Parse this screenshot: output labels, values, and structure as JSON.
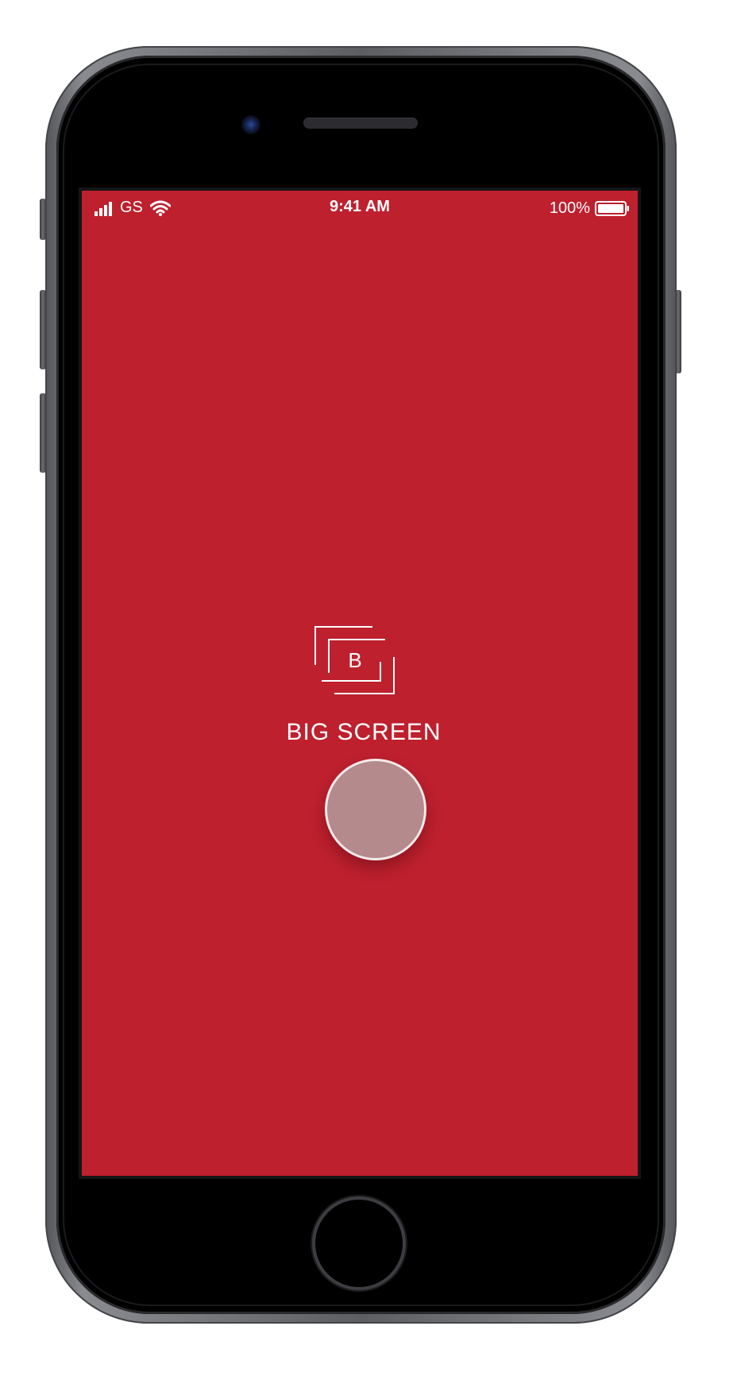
{
  "status_bar": {
    "carrier": "GS",
    "time": "9:41 AM",
    "battery_percent": "100%",
    "signal_icon": "signal-bars-icon",
    "wifi_icon": "wifi-icon",
    "battery_icon": "battery-full-icon"
  },
  "app": {
    "logo_letter": "B",
    "title": "BIG SCREEN",
    "logo_icon": "stacked-frames-logo",
    "record_button_icon": "circle-button"
  },
  "colors": {
    "screen_background": "#be202e",
    "text": "#ffffff",
    "button_fill": "#b48a8c",
    "button_border": "#f4e9ea"
  }
}
